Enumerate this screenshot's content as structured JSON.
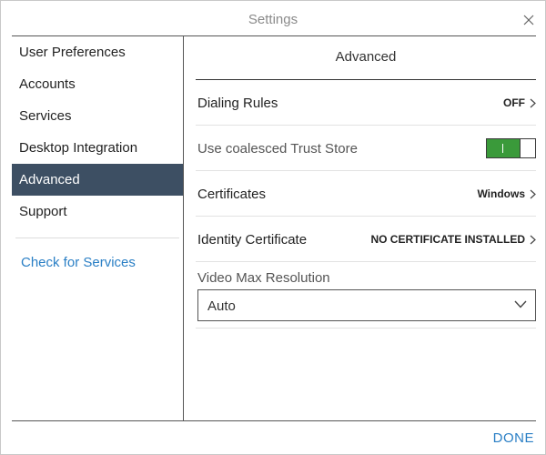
{
  "window": {
    "title": "Settings"
  },
  "sidebar": {
    "items": [
      {
        "label": "User Preferences"
      },
      {
        "label": "Accounts"
      },
      {
        "label": "Services"
      },
      {
        "label": "Desktop Integration"
      },
      {
        "label": "Advanced",
        "active": true
      },
      {
        "label": "Support"
      }
    ],
    "link": "Check for Services"
  },
  "content": {
    "title": "Advanced",
    "dialing_rules": {
      "label": "Dialing Rules",
      "value": "OFF"
    },
    "trust_store": {
      "label": "Use coalesced Trust Store",
      "enabled": true
    },
    "certificates": {
      "label": "Certificates",
      "value": "Windows"
    },
    "identity_certificate": {
      "label": "Identity Certificate",
      "value": "NO CERTIFICATE INSTALLED"
    },
    "video_resolution": {
      "label": "Video Max Resolution",
      "selected": "Auto"
    }
  },
  "footer": {
    "done_label": "DONE"
  },
  "colors": {
    "active_nav_bg": "#3d4f63",
    "link": "#2a7fc5",
    "toggle_on": "#3a9a3a"
  },
  "icons": {
    "close": "close-icon",
    "chevron_right": "chevron-right-icon",
    "chevron_down": "chevron-down-icon"
  }
}
